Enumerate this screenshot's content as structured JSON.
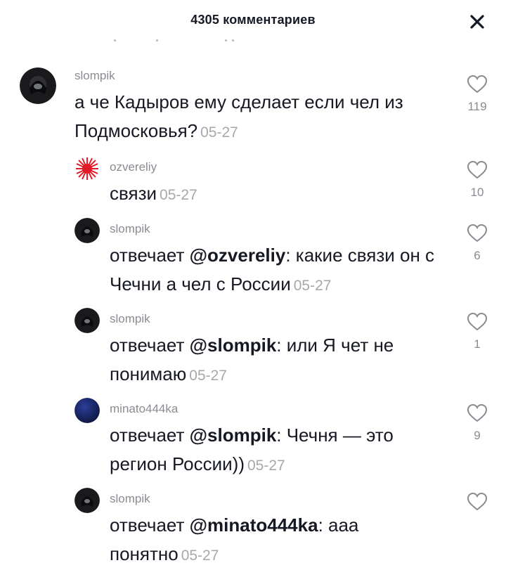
{
  "header": {
    "title": "4305 комментариев"
  },
  "comments": [
    {
      "username": "slompik",
      "text": "а че Кадыров ему сделает если чел из Подмосковья?",
      "date": "05-27",
      "likes": "119"
    },
    {
      "username": "ozvereliy",
      "text": "связи",
      "date": "05-27",
      "likes": "10"
    },
    {
      "username": "slompik",
      "reply_prefix": "отвечает",
      "mention": "@ozvereliy",
      "text": ": какие связи он с Чечни а чел с России",
      "date": "05-27",
      "likes": "6"
    },
    {
      "username": "slompik",
      "reply_prefix": "отвечает",
      "mention": "@slompik",
      "text": ": или Я чет не понимаю",
      "date": "05-27",
      "likes": "1"
    },
    {
      "username": "minato444ka",
      "reply_prefix": "отвечает",
      "mention": "@slompik",
      "text": ": Чечня — это регион России))",
      "date": "05-27",
      "likes": "9"
    },
    {
      "username": "slompik",
      "reply_prefix": "отвечает",
      "mention": "@minato444ka",
      "text": ": ааа понятно",
      "date": "05-27",
      "likes": ""
    }
  ],
  "icons": {
    "close": "close-icon",
    "like": "heart-outline-icon"
  },
  "colors": {
    "text": "#161823",
    "muted": "#8a8b91",
    "date": "#a7a8ad"
  }
}
